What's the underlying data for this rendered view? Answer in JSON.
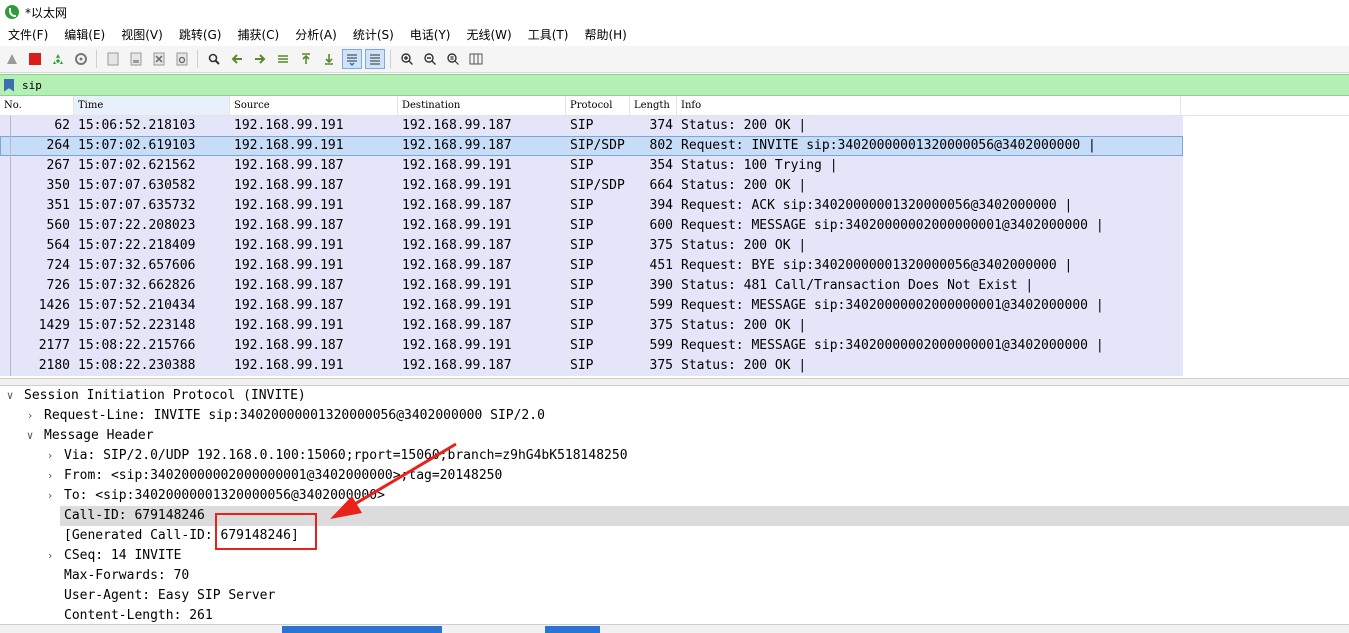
{
  "window": {
    "title": "*以太网"
  },
  "menu": [
    "文件(F)",
    "编辑(E)",
    "视图(V)",
    "跳转(G)",
    "捕获(C)",
    "分析(A)",
    "统计(S)",
    "电话(Y)",
    "无线(W)",
    "工具(T)",
    "帮助(H)"
  ],
  "toolbar": {
    "icons": [
      "shark-fin-start-icon",
      "stop-square-icon",
      "restart-capture-icon",
      "capture-options-gear-icon",
      "open-file-icon",
      "save-file-icon",
      "close-file-icon",
      "reload-icon",
      "find-packet-icon",
      "go-back-icon",
      "go-forward-icon",
      "go-to-packet-icon",
      "go-first-icon",
      "go-last-icon",
      "auto-scroll-icon",
      "colorize-icon",
      "zoom-in-icon",
      "zoom-out-icon",
      "zoom-normal-icon",
      "resize-columns-icon"
    ]
  },
  "filter": {
    "value": "sip"
  },
  "packet_list": {
    "columns": [
      "No.",
      "Time",
      "Source",
      "Destination",
      "Protocol",
      "Length",
      "Info"
    ],
    "rows": [
      {
        "no": "62",
        "time": "15:06:52.218103",
        "src": "192.168.99.191",
        "dst": "192.168.99.187",
        "proto": "SIP",
        "len": "374",
        "info": "Status: 200 OK |"
      },
      {
        "no": "264",
        "time": "15:07:02.619103",
        "src": "192.168.99.191",
        "dst": "192.168.99.187",
        "proto": "SIP/SDP",
        "len": "802",
        "info": "Request: INVITE sip:34020000001320000056@3402000000 |",
        "selected": true
      },
      {
        "no": "267",
        "time": "15:07:02.621562",
        "src": "192.168.99.187",
        "dst": "192.168.99.191",
        "proto": "SIP",
        "len": "354",
        "info": "Status: 100 Trying |"
      },
      {
        "no": "350",
        "time": "15:07:07.630582",
        "src": "192.168.99.187",
        "dst": "192.168.99.191",
        "proto": "SIP/SDP",
        "len": "664",
        "info": "Status: 200 OK |"
      },
      {
        "no": "351",
        "time": "15:07:07.635732",
        "src": "192.168.99.191",
        "dst": "192.168.99.187",
        "proto": "SIP",
        "len": "394",
        "info": "Request: ACK sip:34020000001320000056@3402000000 |"
      },
      {
        "no": "560",
        "time": "15:07:22.208023",
        "src": "192.168.99.187",
        "dst": "192.168.99.191",
        "proto": "SIP",
        "len": "600",
        "info": "Request: MESSAGE sip:34020000002000000001@3402000000 |"
      },
      {
        "no": "564",
        "time": "15:07:22.218409",
        "src": "192.168.99.191",
        "dst": "192.168.99.187",
        "proto": "SIP",
        "len": "375",
        "info": "Status: 200 OK |"
      },
      {
        "no": "724",
        "time": "15:07:32.657606",
        "src": "192.168.99.191",
        "dst": "192.168.99.187",
        "proto": "SIP",
        "len": "451",
        "info": "Request: BYE sip:34020000001320000056@3402000000 |"
      },
      {
        "no": "726",
        "time": "15:07:32.662826",
        "src": "192.168.99.187",
        "dst": "192.168.99.191",
        "proto": "SIP",
        "len": "390",
        "info": "Status: 481 Call/Transaction Does Not Exist |"
      },
      {
        "no": "1426",
        "time": "15:07:52.210434",
        "src": "192.168.99.187",
        "dst": "192.168.99.191",
        "proto": "SIP",
        "len": "599",
        "info": "Request: MESSAGE sip:34020000002000000001@3402000000 |"
      },
      {
        "no": "1429",
        "time": "15:07:52.223148",
        "src": "192.168.99.191",
        "dst": "192.168.99.187",
        "proto": "SIP",
        "len": "375",
        "info": "Status: 200 OK |"
      },
      {
        "no": "2177",
        "time": "15:08:22.215766",
        "src": "192.168.99.187",
        "dst": "192.168.99.191",
        "proto": "SIP",
        "len": "599",
        "info": "Request: MESSAGE sip:34020000002000000001@3402000000 |"
      },
      {
        "no": "2180",
        "time": "15:08:22.230388",
        "src": "192.168.99.191",
        "dst": "192.168.99.187",
        "proto": "SIP",
        "len": "375",
        "info": "Status: 200 OK |"
      }
    ]
  },
  "details": [
    {
      "text": "Session Initiation Protocol (INVITE)",
      "level": 0,
      "expander": "open"
    },
    {
      "text": "Request-Line: INVITE sip:34020000001320000056@3402000000 SIP/2.0",
      "level": 1,
      "expander": "closed"
    },
    {
      "text": "Message Header",
      "level": 1,
      "expander": "open"
    },
    {
      "text": "Via: SIP/2.0/UDP 192.168.0.100:15060;rport=15060;branch=z9hG4bK518148250",
      "level": 2,
      "expander": "closed"
    },
    {
      "text": "From: <sip:34020000002000000001@3402000000>;tag=20148250",
      "level": 2,
      "expander": "closed"
    },
    {
      "text": "To: <sip:34020000001320000056@3402000000>",
      "level": 2,
      "expander": "closed"
    },
    {
      "text": "Call-ID: 679148246",
      "level": 2,
      "expander": "none",
      "highlight": true
    },
    {
      "text": "[Generated Call-ID: 679148246]",
      "level": 2,
      "expander": "none"
    },
    {
      "text": "CSeq: 14 INVITE",
      "level": 2,
      "expander": "closed"
    },
    {
      "text": "Max-Forwards: 70",
      "level": 2,
      "expander": "none"
    },
    {
      "text": "User-Agent: Easy SIP Server",
      "level": 2,
      "expander": "none"
    },
    {
      "text": "Content-Length: 261",
      "level": 2,
      "expander": "none"
    }
  ],
  "colors": {
    "filter_bg": "#b4f0b4",
    "row_bg": "#e5e5f9",
    "selected_row_bg": "#c6dcf7",
    "highlight_row_bg": "#dcdcdc",
    "annotation": "#e8221b"
  }
}
